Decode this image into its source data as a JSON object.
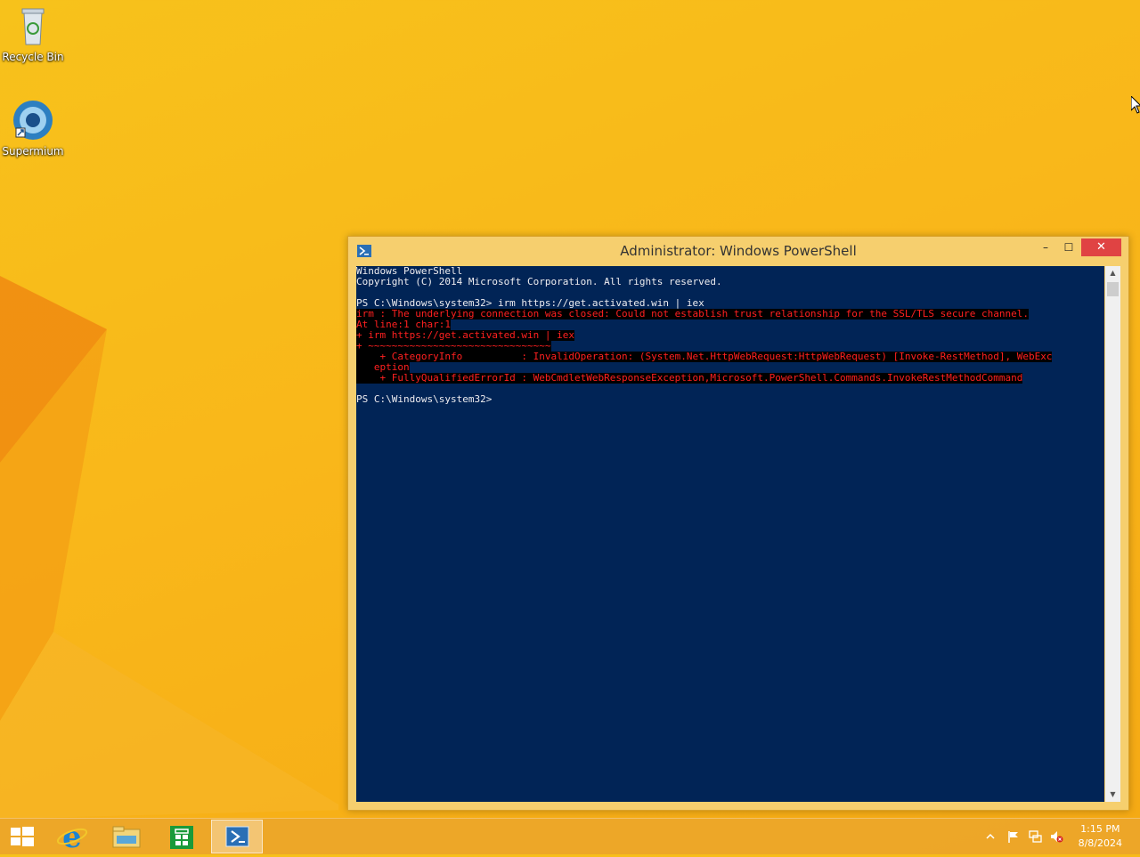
{
  "desktop": {
    "icons": [
      {
        "label": "Recycle Bin",
        "icon": "recycle-bin-icon"
      },
      {
        "label": "Supermium",
        "icon": "supermium-browser-icon"
      }
    ]
  },
  "window": {
    "title": "Administrator: Windows PowerShell",
    "controls": {
      "minimize": "–",
      "maximize": "☐",
      "close": "✕"
    },
    "console_lines": [
      {
        "text": "Windows PowerShell",
        "error": false
      },
      {
        "text": "Copyright (C) 2014 Microsoft Corporation. All rights reserved.",
        "error": false
      },
      {
        "text": "",
        "error": false
      },
      {
        "text": "PS C:\\Windows\\system32> irm https://get.activated.win | iex",
        "error": false
      },
      {
        "text": "irm : The underlying connection was closed: Could not establish trust relationship for the SSL/TLS secure channel.",
        "error": true
      },
      {
        "text": "At line:1 char:1",
        "error": true
      },
      {
        "text": "+ irm https://get.activated.win | iex",
        "error": true
      },
      {
        "text": "+ ~~~~~~~~~~~~~~~~~~~~~~~~~~~~~~~",
        "error": true
      },
      {
        "text": "    + CategoryInfo          : InvalidOperation: (System.Net.HttpWebRequest:HttpWebRequest) [Invoke-RestMethod], WebExc",
        "error": true
      },
      {
        "text": "   eption",
        "error": true
      },
      {
        "text": "    + FullyQualifiedErrorId : WebCmdletWebResponseException,Microsoft.PowerShell.Commands.InvokeRestMethodCommand",
        "error": true
      },
      {
        "text": "",
        "error": false
      },
      {
        "text": "PS C:\\Windows\\system32>",
        "error": false
      }
    ]
  },
  "taskbar": {
    "buttons": [
      {
        "name": "start-button",
        "icon": "windows-logo-icon"
      },
      {
        "name": "internet-explorer-button",
        "icon": "internet-explorer-icon"
      },
      {
        "name": "file-explorer-button",
        "icon": "folder-icon"
      },
      {
        "name": "store-button",
        "icon": "store-icon"
      },
      {
        "name": "powershell-taskbar-button",
        "icon": "powershell-icon",
        "active": true
      }
    ],
    "tray": {
      "clock_time": "1:15 PM",
      "clock_date": "8/8/2024",
      "icons": [
        "show-hidden-icons-chevron-icon",
        "action-center-flag-icon",
        "network-icon",
        "volume-muted-icon"
      ]
    }
  },
  "colors": {
    "console_bg": "#012456",
    "error_fg": "#ff2020",
    "window_frame": "#f6cf6e",
    "close_button": "#e04343"
  }
}
